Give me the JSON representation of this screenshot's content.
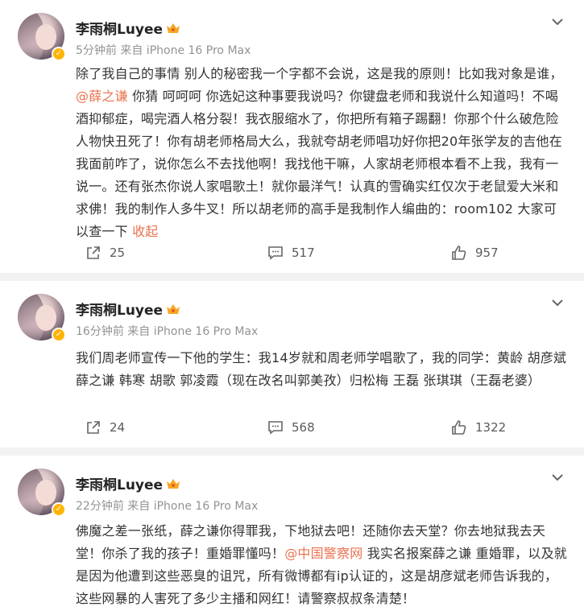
{
  "posts": [
    {
      "user": "李雨桐Luyee",
      "meta": "5分钟前  来自 iPhone 16 Pro Max",
      "content": {
        "part1": "除了我自己的事情 别人的秘密我一个字都不会说，这是我的原则！比如我对象是谁，",
        "mention": "@薛之谦",
        "part2": " 你猜 呵呵呵 你选妃这种事要我说吗？你键盘老师和我说什么知道吗！不喝酒抑郁症，喝完酒人格分裂！我衣服缩水了，你把所有箱子踢翻！你那个什么破危险人物快丑死了！你有胡老师格局大么，我就夸胡老师唱功好你把20年张学友的吉他在我面前咋了，说你怎么不去找他啊！我找他干嘛，人家胡老师根本看不上我，我有一说一。还有张杰你说人家唱歌土！就你最洋气！认真的雪确实红仅次于老鼠爱大米和求佛！我的制作人多牛叉！所以胡老师的高手是我制作人编曲的：room102 大家可以查一下 ",
        "collapse": "收起"
      },
      "reposts": "25",
      "comments": "517",
      "likes": "957"
    },
    {
      "user": "李雨桐Luyee",
      "meta": "16分钟前  来自 iPhone 16 Pro Max",
      "content": {
        "part1": "我们周老师宣传一下他的学生：我14岁就和周老师学唱歌了，我的同学：黄龄 胡彦斌 薛之谦 韩寒 胡歌 郭凌霞（现在改名叫郭美孜）归松梅 王磊 张琪琪（王磊老婆）"
      },
      "reposts": "24",
      "comments": "568",
      "likes": "1322"
    },
    {
      "user": "李雨桐Luyee",
      "meta": "22分钟前  来自 iPhone 16 Pro Max",
      "content": {
        "part1": "佛魔之差一张纸，薛之谦你得罪我，下地狱去吧！还随你去天堂？你去地狱我去天堂！你杀了我的孩子！重婚罪懂吗！",
        "mention": "@中国警察网",
        "part2": " 我实名报案薛之谦 重婚罪，以及就是因为他遭到这些恶臭的诅咒，所有微博都有ip认证的，这是胡彦斌老师告诉我的，这些网暴的人害死了多少主播和网红！请警察叔叔条清楚！"
      }
    }
  ],
  "colors": {
    "mention": "#eb7350",
    "badge": "#ffb400",
    "meta": "#939393"
  },
  "icons": [
    "avatar",
    "verified-badge-icon",
    "crown-icon",
    "chevron-down-icon",
    "repost-icon",
    "comment-icon",
    "like-icon"
  ]
}
